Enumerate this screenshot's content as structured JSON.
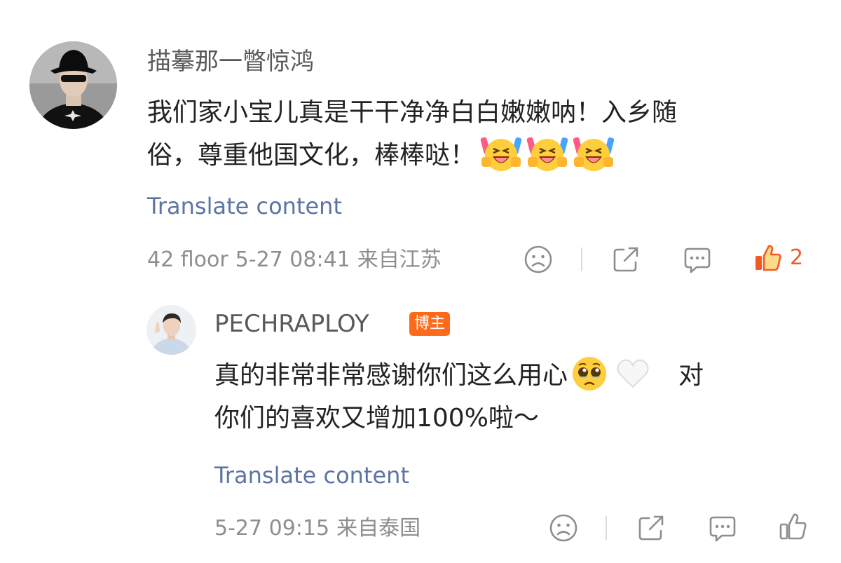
{
  "main_comment": {
    "username": "描摹那一瞥惊鸿",
    "text_line1": "我们家小宝儿真是干干净净白白嫩嫩呐！入乡随",
    "text_line2": "俗，尊重他国文化，棒棒哒！",
    "emojis": [
      "laughing-crying-emoji",
      "laughing-crying-emoji",
      "laughing-crying-emoji"
    ],
    "translate_label": "Translate content",
    "floor": "42 floor",
    "time": "5-27 08:41",
    "location": "来自江苏",
    "like_count": "2",
    "like_active_color": "#F25A22"
  },
  "reply": {
    "username": "PECHRAPLOY",
    "badge": "博主",
    "text_line1_part1": "真的非常非常感谢你们这么用心",
    "text_line1_part2": "对",
    "text_line2": "你们的喜欢又增加100%啦～",
    "emojis": [
      "pleading-face-emoji",
      "white-heart-emoji"
    ],
    "translate_label": "Translate content",
    "time": "5-27 09:15",
    "location": "来自泰国"
  },
  "colors": {
    "link": "#5C74A3",
    "meta": "#8E8E8E",
    "badge": "#FF6A1A",
    "text": "#222222"
  }
}
